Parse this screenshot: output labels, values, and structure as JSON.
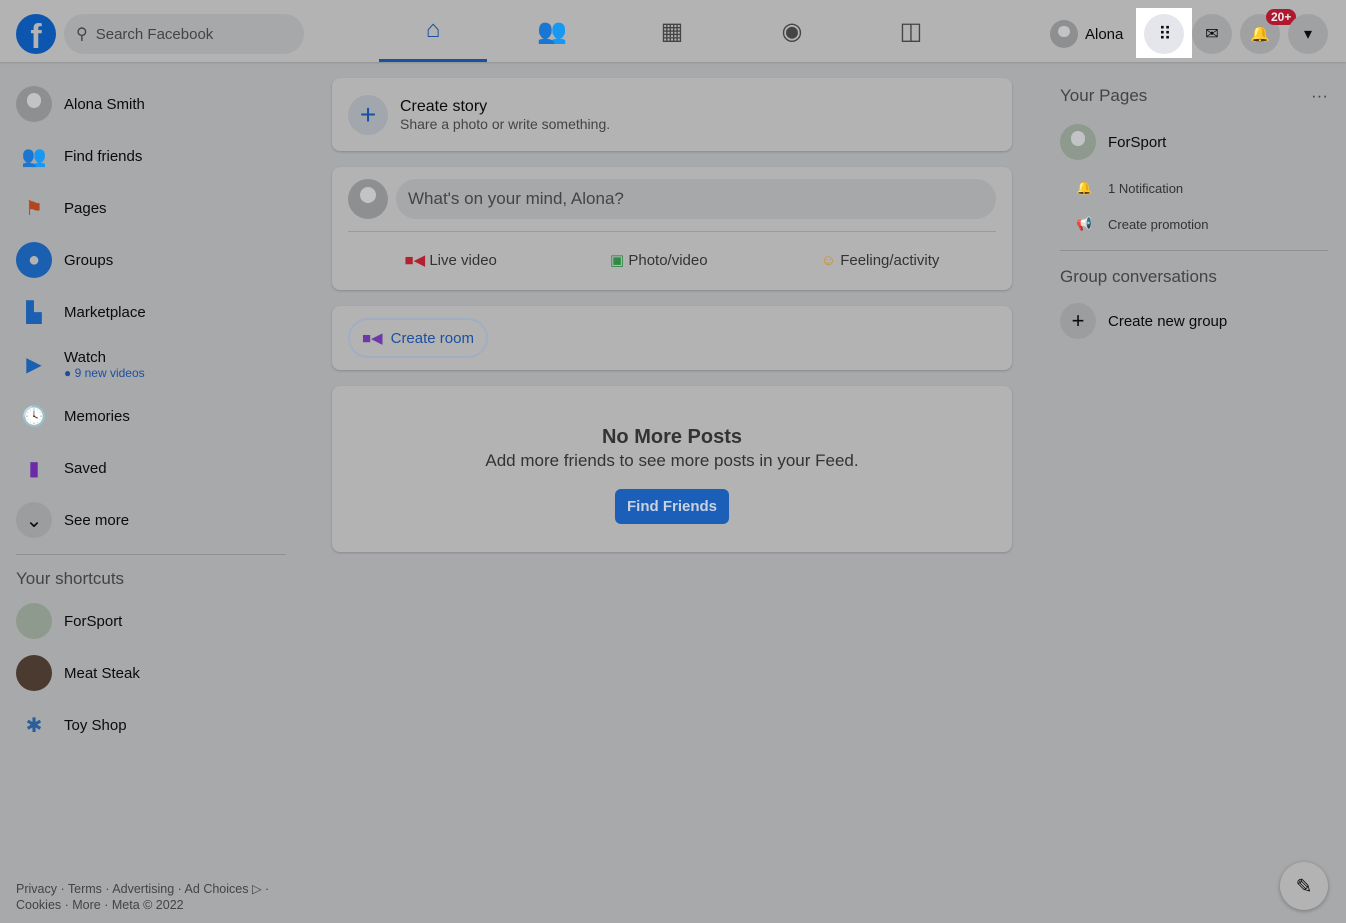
{
  "header": {
    "search_placeholder": "Search Facebook",
    "user": "Alona",
    "notif_badge": "20+"
  },
  "sidebar": {
    "items": [
      {
        "label": "Alona Smith"
      },
      {
        "label": "Find friends"
      },
      {
        "label": "Pages"
      },
      {
        "label": "Groups"
      },
      {
        "label": "Marketplace"
      },
      {
        "label": "Watch",
        "sub": "9 new videos"
      },
      {
        "label": "Memories"
      },
      {
        "label": "Saved"
      },
      {
        "label": "See more"
      }
    ],
    "shortcuts_title": "Your shortcuts",
    "shortcuts": [
      "ForSport",
      "Meat Steak",
      "Toy Shop"
    ]
  },
  "footer": {
    "line1": "Privacy · Terms · Advertising · Ad Choices ▷ ·",
    "line2": "Cookies · More · Meta © 2022"
  },
  "feed": {
    "story_title": "Create story",
    "story_sub": "Share a photo or write something.",
    "composer_placeholder": "What's on your mind, Alona?",
    "live": "Live video",
    "photo": "Photo/video",
    "feeling": "Feeling/activity",
    "room": "Create room",
    "nomore_title": "No More Posts",
    "nomore_sub": "Add more friends to see more posts in your Feed.",
    "find_friends": "Find Friends"
  },
  "right": {
    "pages_title": "Your Pages",
    "page": "ForSport",
    "notification": "1 Notification",
    "promotion": "Create promotion",
    "groups_title": "Group conversations",
    "new_group": "Create new group"
  }
}
